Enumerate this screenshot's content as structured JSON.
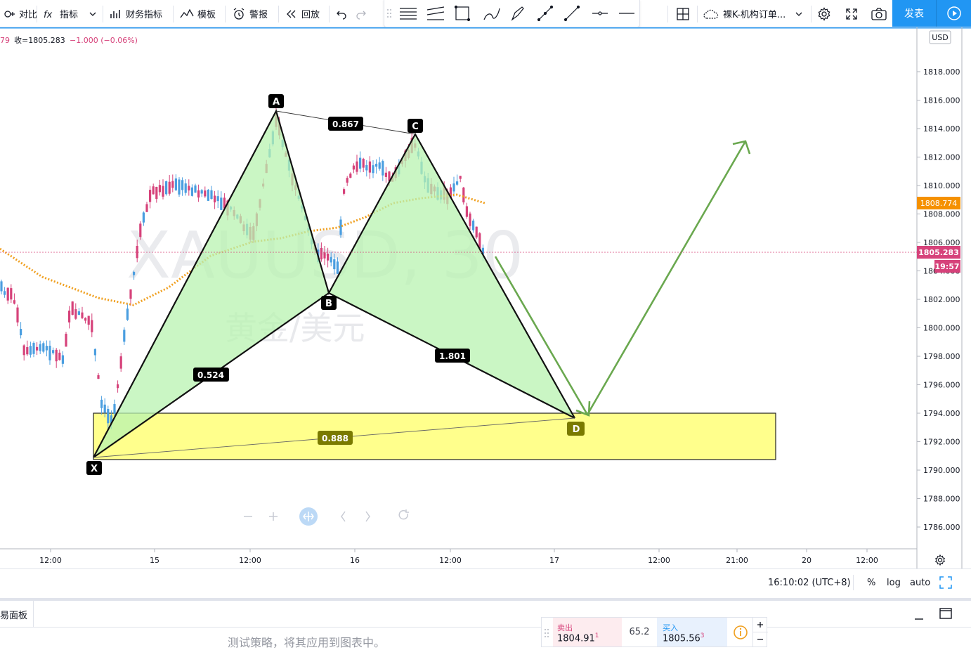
{
  "toolbar": {
    "compare": "对比",
    "indicators": "指标",
    "financials": "财务指标",
    "templates": "模板",
    "alerts": "警报",
    "replay": "回放",
    "layout_name": "裸K-机构订单...",
    "publish": "发表"
  },
  "legend": {
    "left_fragment": "79",
    "close_label": "收=1805.283",
    "change": "−1.000 (−0.06%)"
  },
  "watermark": {
    "symbol": "XAUUSD, 30",
    "name": "黄金/美元"
  },
  "price_axis": {
    "currency": "USD",
    "ticks": [
      "1818.000",
      "1816.000",
      "1814.000",
      "1812.000",
      "1810.000",
      "1808.000",
      "1806.000",
      "1804.000",
      "1802.000",
      "1800.000",
      "1798.000",
      "1796.000",
      "1794.000",
      "1792.000",
      "1790.000",
      "1788.000",
      "1786.000"
    ],
    "ma_label": "1808.774",
    "price_label": "1805.283",
    "countdown": "19:57"
  },
  "time_axis": {
    "ticks": [
      "12:00",
      "15",
      "12:00",
      "16",
      "12:00",
      "17",
      "12:00",
      "21:00",
      "20",
      "12:00"
    ]
  },
  "pattern": {
    "points": [
      "X",
      "A",
      "B",
      "C",
      "D"
    ],
    "ratios": {
      "xb": "0.524",
      "ac": "0.867",
      "bd": "1.801",
      "xd": "0.888"
    }
  },
  "status": {
    "time": "16:10:02 (UTC+8)",
    "percent": "%",
    "log": "log",
    "auto": "auto"
  },
  "bottom": {
    "panel_tab": "易面板",
    "hint": "测试策略，将其应用到图表中。",
    "sell_label": "卖出",
    "sell_price": "1804.91",
    "sell_sup": "1",
    "spread": "65.2",
    "buy_label": "买入",
    "buy_price": "1805.56",
    "buy_sup": "3"
  },
  "colors": {
    "up": "#4a9ee0",
    "down": "#d6427a",
    "ma": "#f0a020",
    "pattern_fill": "#b8f3b0",
    "zone_fill": "#ffff80",
    "projection": "#6aa84f",
    "accent": "#2196f3"
  }
}
